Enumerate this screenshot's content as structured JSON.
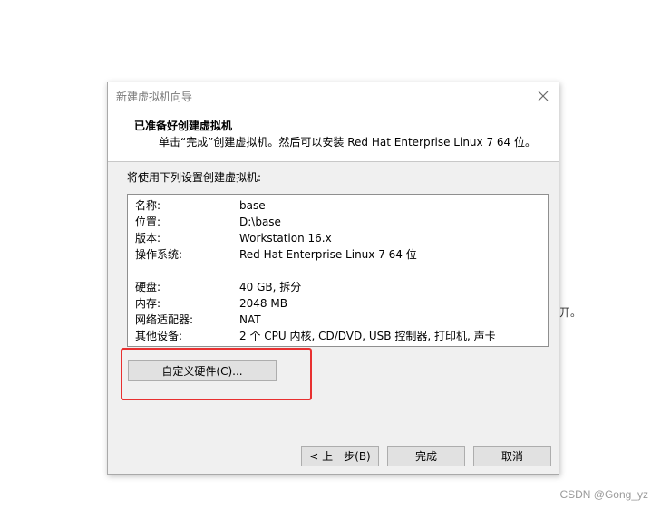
{
  "background": {
    "fragment": "开。",
    "watermark": "CSDN @Gong_yz"
  },
  "dialog": {
    "title": "新建虚拟机向导",
    "close_icon": "close-icon",
    "header": {
      "title": "已准备好创建虚拟机",
      "subtitle": "单击“完成”创建虚拟机。然后可以安装 Red Hat Enterprise Linux 7 64 位。"
    },
    "intro": "将使用下列设置创建虚拟机:",
    "settings": [
      {
        "label": "名称:",
        "value": "base"
      },
      {
        "label": "位置:",
        "value": "D:\\base"
      },
      {
        "label": "版本:",
        "value": "Workstation 16.x"
      },
      {
        "label": "操作系统:",
        "value": "Red Hat Enterprise Linux 7 64 位"
      },
      {
        "label": "硬盘:",
        "value": "40 GB, 拆分"
      },
      {
        "label": "内存:",
        "value": "2048 MB"
      },
      {
        "label": "网络适配器:",
        "value": "NAT"
      },
      {
        "label": "其他设备:",
        "value": "2 个 CPU 内核, CD/DVD, USB 控制器, 打印机, 声卡"
      }
    ],
    "customize_label": "自定义硬件(C)...",
    "buttons": {
      "back": "< 上一步(B)",
      "finish": "完成",
      "cancel": "取消"
    }
  },
  "colors": {
    "highlight": "#e83030",
    "dialog_bg": "#f0f0f0",
    "button_bg": "#e1e1e1"
  }
}
